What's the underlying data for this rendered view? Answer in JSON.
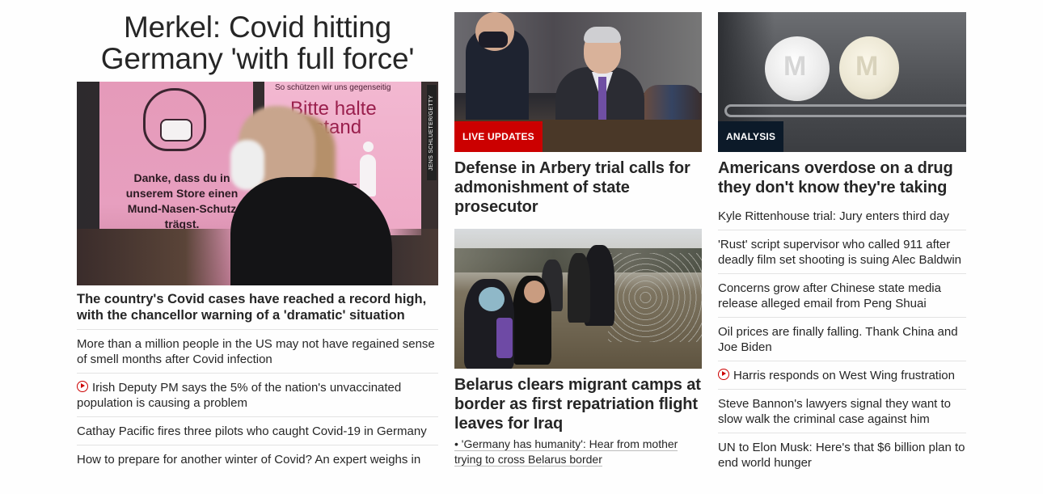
{
  "left": {
    "headline": "Merkel: Covid hitting Germany 'with full force'",
    "photo_credit": "JENS SCHLUETER/GETTY IMAGES",
    "image_sign": {
      "small_text": "So schützen wir uns gegenseitig",
      "big_text": "Bitte halte Abstand",
      "body_text": "Danke, dass du in unserem Store einen Mund-Nasen-Schutz trägst."
    },
    "lead": "The country's Covid cases have reached a record high, with the chancellor warning of a 'dramatic' situation",
    "links": [
      {
        "text": "More than a million people in the US may not have regained sense of smell months after Covid infection",
        "video": false
      },
      {
        "text": "Irish Deputy PM says the 5% of the nation's unvaccinated population is causing a problem",
        "video": true
      },
      {
        "text": "Cathay Pacific fires three pilots who caught Covid-19 in Germany",
        "video": false
      },
      {
        "text": "How to prepare for another winter of Covid? An expert weighs in",
        "video": false
      }
    ]
  },
  "middle": {
    "card1": {
      "badge": "LIVE UPDATES",
      "title": "Defense in Arbery trial calls for admonishment of state prosecutor"
    },
    "card2": {
      "title": "Belarus clears migrant camps at border as first repatriation flight leaves for Iraq",
      "sub_link": "• 'Germany has humanity': Hear from mother trying to cross Belarus border"
    }
  },
  "right": {
    "card": {
      "badge": "ANALYSIS",
      "title": "Americans overdose on a drug they don't know they're taking",
      "pill_letter": "M"
    },
    "links": [
      {
        "text": "Kyle Rittenhouse trial: Jury enters third day",
        "video": false
      },
      {
        "text": "'Rust' script supervisor who called 911 after deadly film set shooting is suing Alec Baldwin",
        "video": false
      },
      {
        "text": "Concerns grow after Chinese state media release alleged email from Peng Shuai",
        "video": false
      },
      {
        "text": "Oil prices are finally falling. Thank China and Joe Biden",
        "video": false
      },
      {
        "text": "Harris responds on West Wing frustration",
        "video": true
      },
      {
        "text": "Steve Bannon's lawyers signal they want to slow walk the criminal case against him",
        "video": false
      },
      {
        "text": "UN to Elon Musk: Here's that $6 billion plan to end world hunger",
        "video": false
      }
    ]
  },
  "colors": {
    "text": "#262626",
    "badge_red": "#cc0000",
    "badge_dark": "#0c1a29",
    "divider": "#e3e3e3",
    "video_icon": "#cc0000"
  }
}
